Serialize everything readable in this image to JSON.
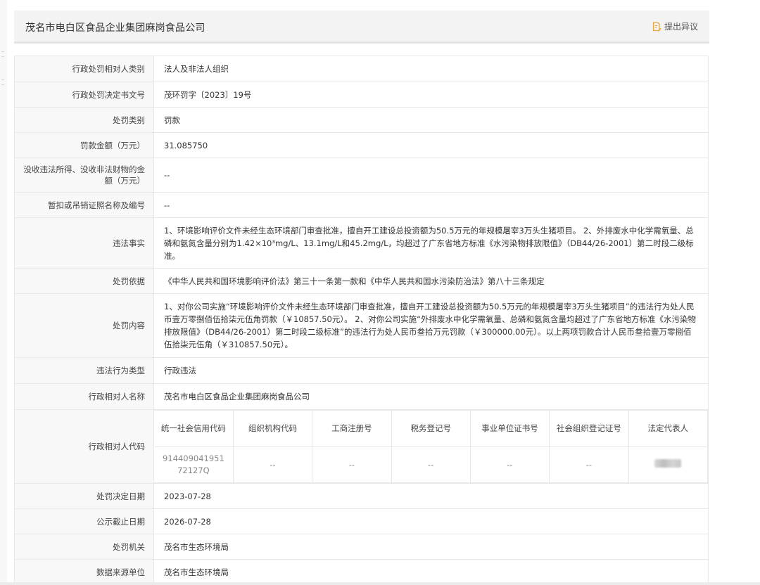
{
  "company_title": "茂名市电白区食品企业集团麻岗食品公司",
  "objection_label": "提出异议",
  "rows": {
    "party_type": {
      "label": "行政处罚相对人类别",
      "value": "法人及非法人组织"
    },
    "doc_no": {
      "label": "行政处罚决定书文号",
      "value": "茂环罚字〔2023〕19号"
    },
    "penalty_type": {
      "label": "处罚类别",
      "value": "罚款"
    },
    "amount": {
      "label": "罚款金额（万元）",
      "value": "31.085750"
    },
    "confiscated": {
      "label": "没收违法所得、没收非法财物的金额（万元）",
      "value": "--"
    },
    "license": {
      "label": "暂扣或吊销证照名称及编号",
      "value": "--"
    },
    "facts": {
      "label": "违法事实",
      "value": "1、环境影响评价文件未经生态环境部门审查批准，擅自开工建设总投资额为50.5万元的年规模屠宰3万头生猪项目。 2、外排废水中化学需氧量、总磷和氨氮含量分别为1.42×10³mg/L、13.1mg/L和45.2mg/L，均超过了广东省地方标准《水污染物排放限值》（DB44/26-2001）第二时段二级标准。"
    },
    "basis": {
      "label": "处罚依据",
      "value": "《中华人民共和国环境影响评价法》第三十一条第一款和《中华人民共和国水污染防治法》第八十三条规定"
    },
    "content": {
      "label": "处罚内容",
      "value": "1、对你公司实施“环境影响评价文件未经生态环境部门审查批准，擅自开工建设总投资额为50.5万元的年规模屠宰3万头生猪项目”的违法行为处人民币壹万零捌佰伍拾柒元伍角罚款（￥10857.50元）。 2、对你公司实施“外排废水中化学需氧量、总磷和氨氮含量均超过了广东省地方标准《水污染物排放限值》（DB44/26-2001）第二时段二级标准”的违法行为处人民币叁拾万元罚款（￥300000.00元）。以上两项罚款合计人民币叁拾壹万零捌佰伍拾柒元伍角（￥310857.50元）。"
    },
    "violation_type": {
      "label": "违法行为类型",
      "value": "行政违法"
    },
    "party_name": {
      "label": "行政相对人名称",
      "value": "茂名市电白区食品企业集团麻岗食品公司"
    },
    "party_code": {
      "label": "行政相对人代码"
    },
    "decision_date": {
      "label": "处罚决定日期",
      "value": "2023-07-28"
    },
    "expiry_date": {
      "label": "公示截止日期",
      "value": "2026-07-28"
    },
    "authority": {
      "label": "处罚机关",
      "value": "茂名市生态环境局"
    },
    "source": {
      "label": "数据来源单位",
      "value": "茂名市生态环境局"
    }
  },
  "codes": {
    "headers": [
      "统一社会信用代码",
      "组织机构代码",
      "工商注册号",
      "税务登记号",
      "事业单位证书号",
      "社会组织登记证号",
      "法定代表人"
    ],
    "values": [
      "914409041951 72127Q",
      "--",
      "--",
      "--",
      "--",
      "--",
      ""
    ]
  },
  "icons": {
    "objection": "document-edit-icon"
  },
  "colors": {
    "accent": "#e8a33d",
    "label_bg": "#f8f8f8",
    "header_bg": "#f3f3f3",
    "border": "#e8e8e8"
  }
}
